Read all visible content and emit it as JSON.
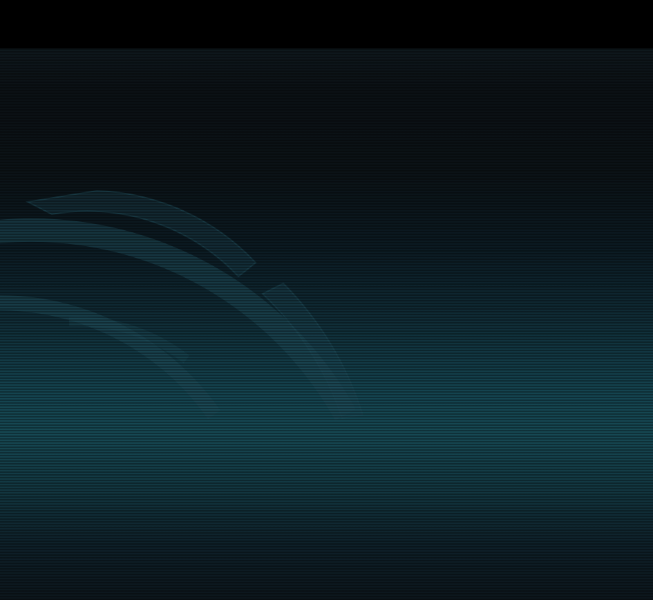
{
  "screen": {
    "top_bar": {},
    "background": {
      "colors": {
        "dark": "#0b1014",
        "teal": "#164853",
        "emblem": "#1f4a58"
      },
      "emblem_icon": "ring-segment-emblem"
    }
  }
}
